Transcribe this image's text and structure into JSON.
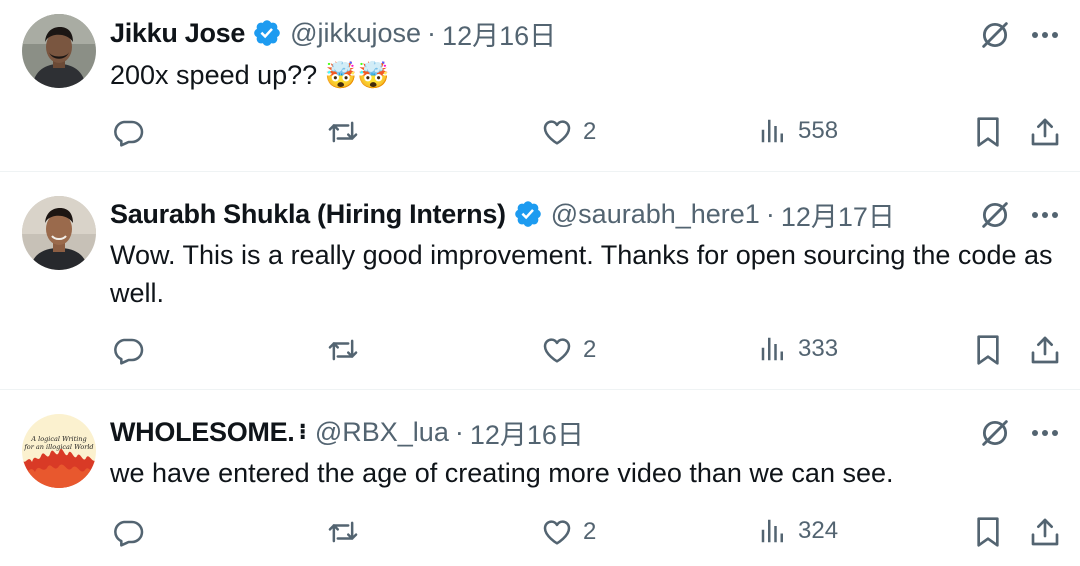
{
  "tweets": [
    {
      "name": "Jikku Jose",
      "name_extra": "",
      "handle": "@jikkujose",
      "date": "12月16日",
      "text": "200x speed up??",
      "emoji": "🤯🤯",
      "replies": "",
      "reposts": "",
      "likes": "2",
      "views": "558",
      "verified": true
    },
    {
      "name": "Saurabh Shukla (Hiring Interns)",
      "name_extra": "",
      "handle": "@saurabh_here1",
      "date": "12月17日",
      "text": "Wow. This is a really good improvement. Thanks for open sourcing the code as well.",
      "emoji": "",
      "replies": "",
      "reposts": "",
      "likes": "2",
      "views": "333",
      "verified": true
    },
    {
      "name": "WHOLESOME.",
      "name_extra": "⁝",
      "handle": "@RBX_lua",
      "date": "12月16日",
      "text": "we have entered the age of creating more video than we can see.",
      "emoji": "",
      "replies": "",
      "reposts": "",
      "likes": "2",
      "views": "324",
      "verified": false,
      "avatar_text": "A logical Writing for an illogical World"
    }
  ],
  "separator": "·",
  "colors": {
    "verified": "#1d9bf0",
    "muted": "#536471",
    "text": "#0f1419",
    "divider": "#eff3f4"
  },
  "icons": [
    "reply-icon",
    "repost-icon",
    "like-icon",
    "views-icon",
    "bookmark-icon",
    "share-icon",
    "grok-icon",
    "more-icon",
    "verified-badge-icon"
  ]
}
